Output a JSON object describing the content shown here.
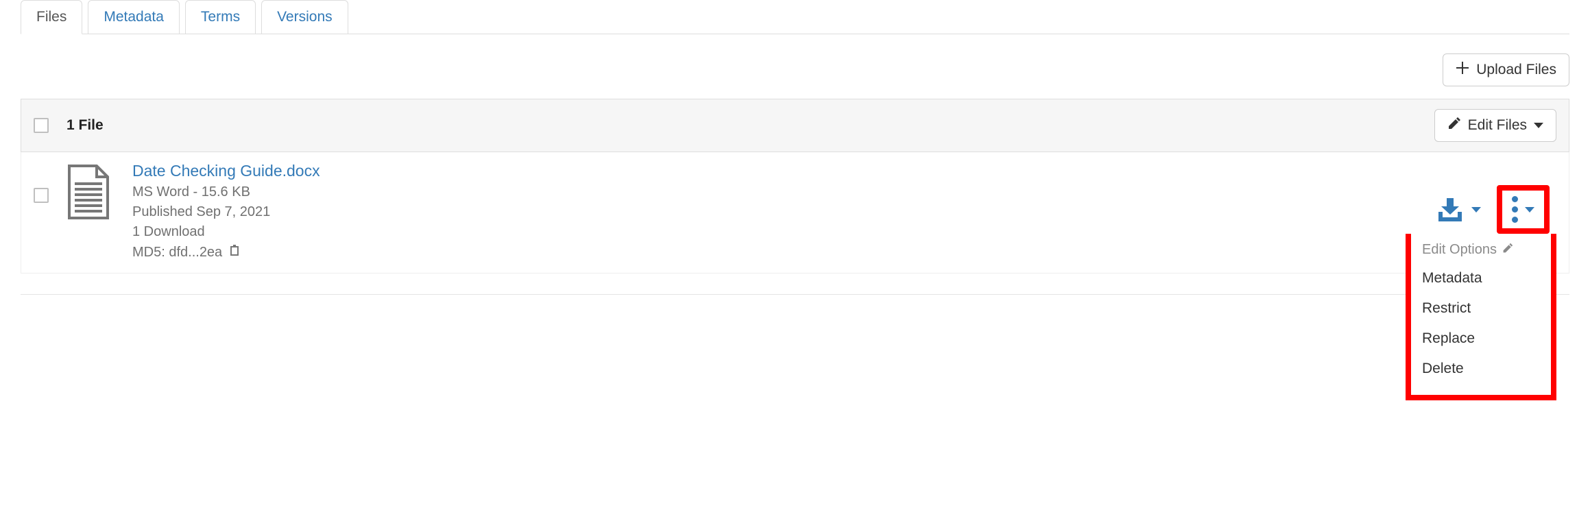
{
  "tabs": {
    "files": "Files",
    "metadata": "Metadata",
    "terms": "Terms",
    "versions": "Versions"
  },
  "toolbar": {
    "upload_label": "Upload Files",
    "edit_files_label": "Edit Files"
  },
  "files": {
    "count_label": "1 File"
  },
  "file": {
    "name": "Date Checking Guide.docx",
    "type_size": "MS Word - 15.6 KB",
    "published": "Published Sep 7, 2021",
    "downloads": "1 Download",
    "md5": "MD5: dfd...2ea"
  },
  "dropdown": {
    "header": "Edit Options",
    "items": {
      "metadata": "Metadata",
      "restrict": "Restrict",
      "replace": "Replace",
      "delete": "Delete"
    }
  }
}
